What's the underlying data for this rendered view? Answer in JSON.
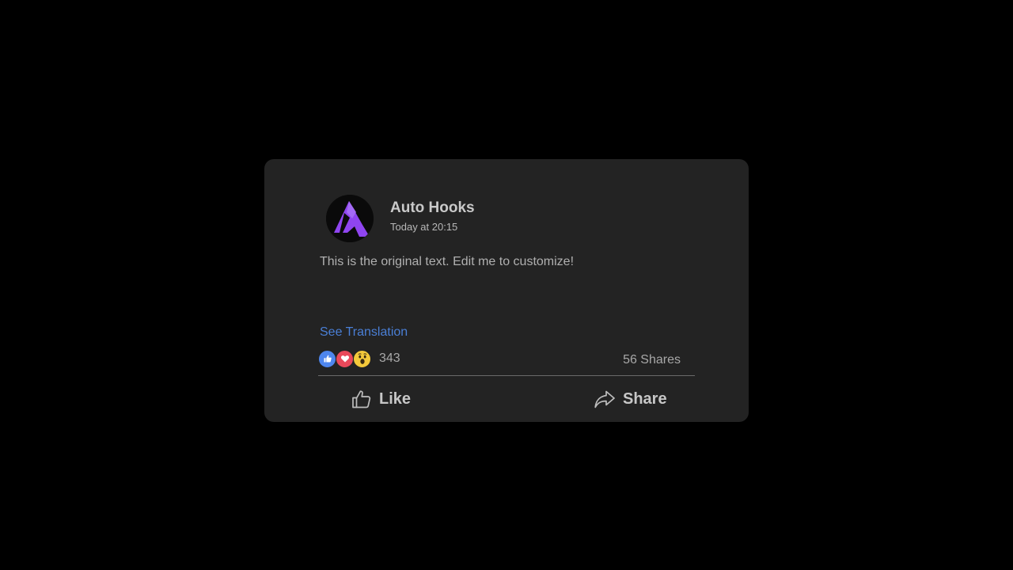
{
  "post": {
    "author": "Auto Hooks",
    "timestamp": "Today at 20:15",
    "text": "This is the original text. Edit me to customize!",
    "translation_link": "See Translation",
    "avatar_icon": "auto-hooks-logo-icon"
  },
  "stats": {
    "reactions_count": "343",
    "reaction_icons": [
      "like-reaction-icon",
      "love-reaction-icon",
      "wow-reaction-icon"
    ],
    "shares": "56 Shares"
  },
  "actions": {
    "like_label": "Like",
    "like_icon": "thumbs-up-icon",
    "share_label": "Share",
    "share_icon": "share-arrow-icon"
  },
  "colors": {
    "background": "#000000",
    "card": "#232323",
    "link": "#4a7fd6",
    "logo_purple": "#8f45f0",
    "like_blue": "#4e86ee",
    "love_red": "#e9485a",
    "wow_yellow": "#f4c93b"
  }
}
